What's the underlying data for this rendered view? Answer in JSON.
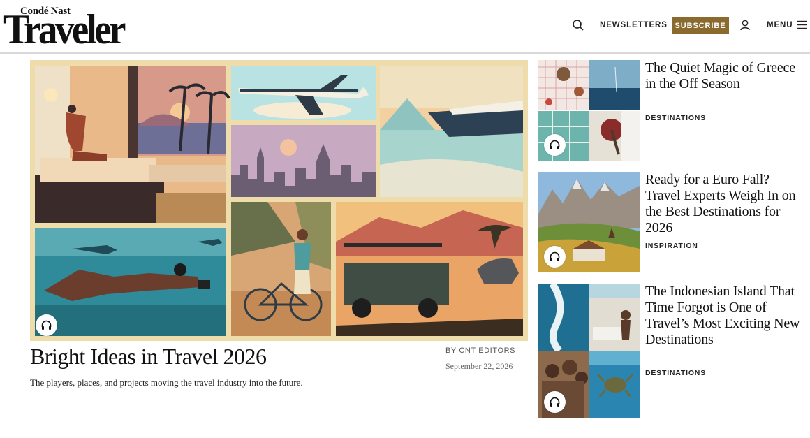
{
  "header": {
    "logo_small": "Condé Nast",
    "logo_big": "Traveler",
    "newsletters_label": "NEWSLETTERS",
    "subscribe_label": "SUBSCRIBE",
    "menu_label": "MENU",
    "icons": [
      "search-icon",
      "account-icon",
      "hamburger-menu-icon"
    ],
    "subscribe_color": "#8b6a2f"
  },
  "hero": {
    "title": "Bright Ideas in Travel 2026",
    "dek": "The players, places, and projects moving the travel industry into the future.",
    "byline": "BY CNT EDITORS",
    "date": "September 22, 2026",
    "audio_icon": "headphones-icon"
  },
  "stories": [
    {
      "title": "The Quiet Magic of Greece in the Off Season",
      "tag": "DESTINATIONS",
      "audio_icon": "headphones-icon"
    },
    {
      "title": "Ready for a Euro Fall? Travel Experts Weigh In on the Best Destinations for 2026",
      "tag": "INSPIRATION",
      "audio_icon": "headphones-icon"
    },
    {
      "title": "The Indonesian Island That Time Forgot is One of Travel’s Most Exciting New Destinations",
      "tag": "DESTINATIONS",
      "audio_icon": "headphones-icon"
    }
  ]
}
